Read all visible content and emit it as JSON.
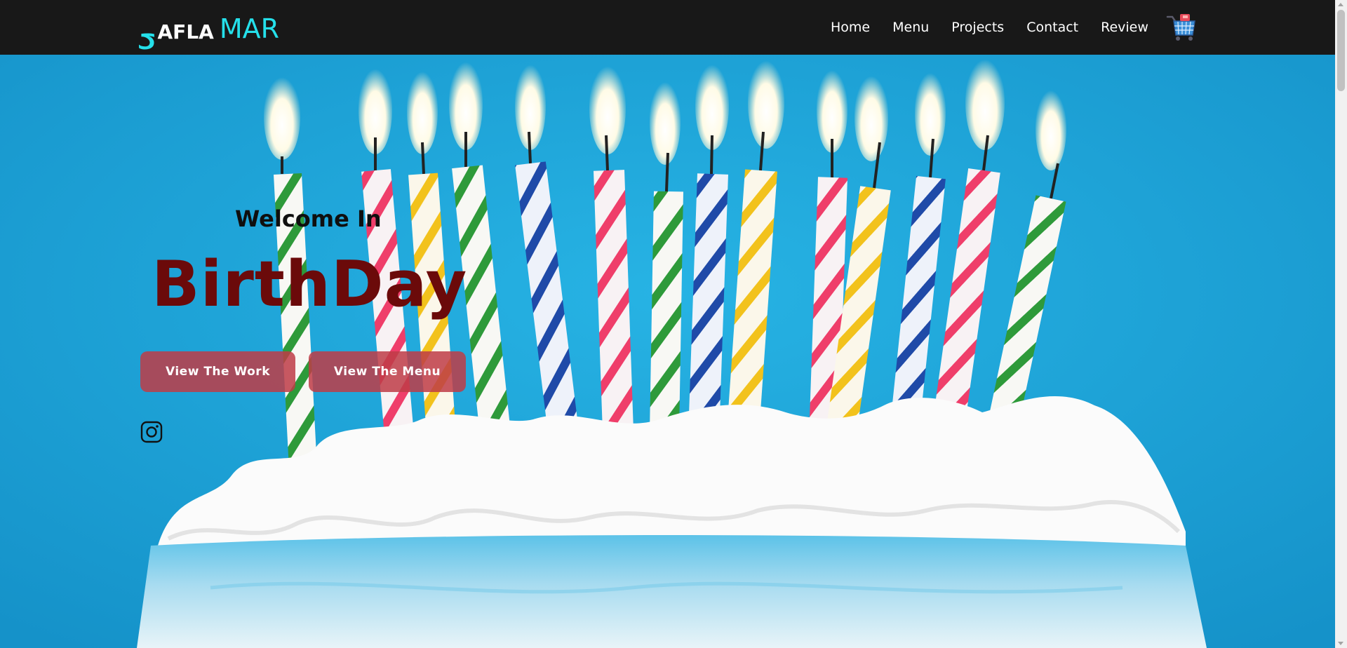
{
  "brand": {
    "arabic_glyph": "ح",
    "afla": "AFLA",
    "mar": "MAR"
  },
  "nav": {
    "links": [
      "Home",
      "Menu",
      "Projects",
      "Contact",
      "Review"
    ]
  },
  "hero": {
    "welcome": "Welcome In",
    "title": "BirthDay",
    "buttons": {
      "work": "View The Work",
      "menu": "View The Menu"
    }
  },
  "icons": {
    "cart": "shopping-cart-icon",
    "social": "instagram-icon"
  },
  "colors": {
    "navbar_bg": "#181818",
    "brand_accent": "#25e0ea",
    "hero_sky": "#1e9fd3",
    "title_color": "#6b0a0a",
    "button_bg": "#be3c46"
  }
}
